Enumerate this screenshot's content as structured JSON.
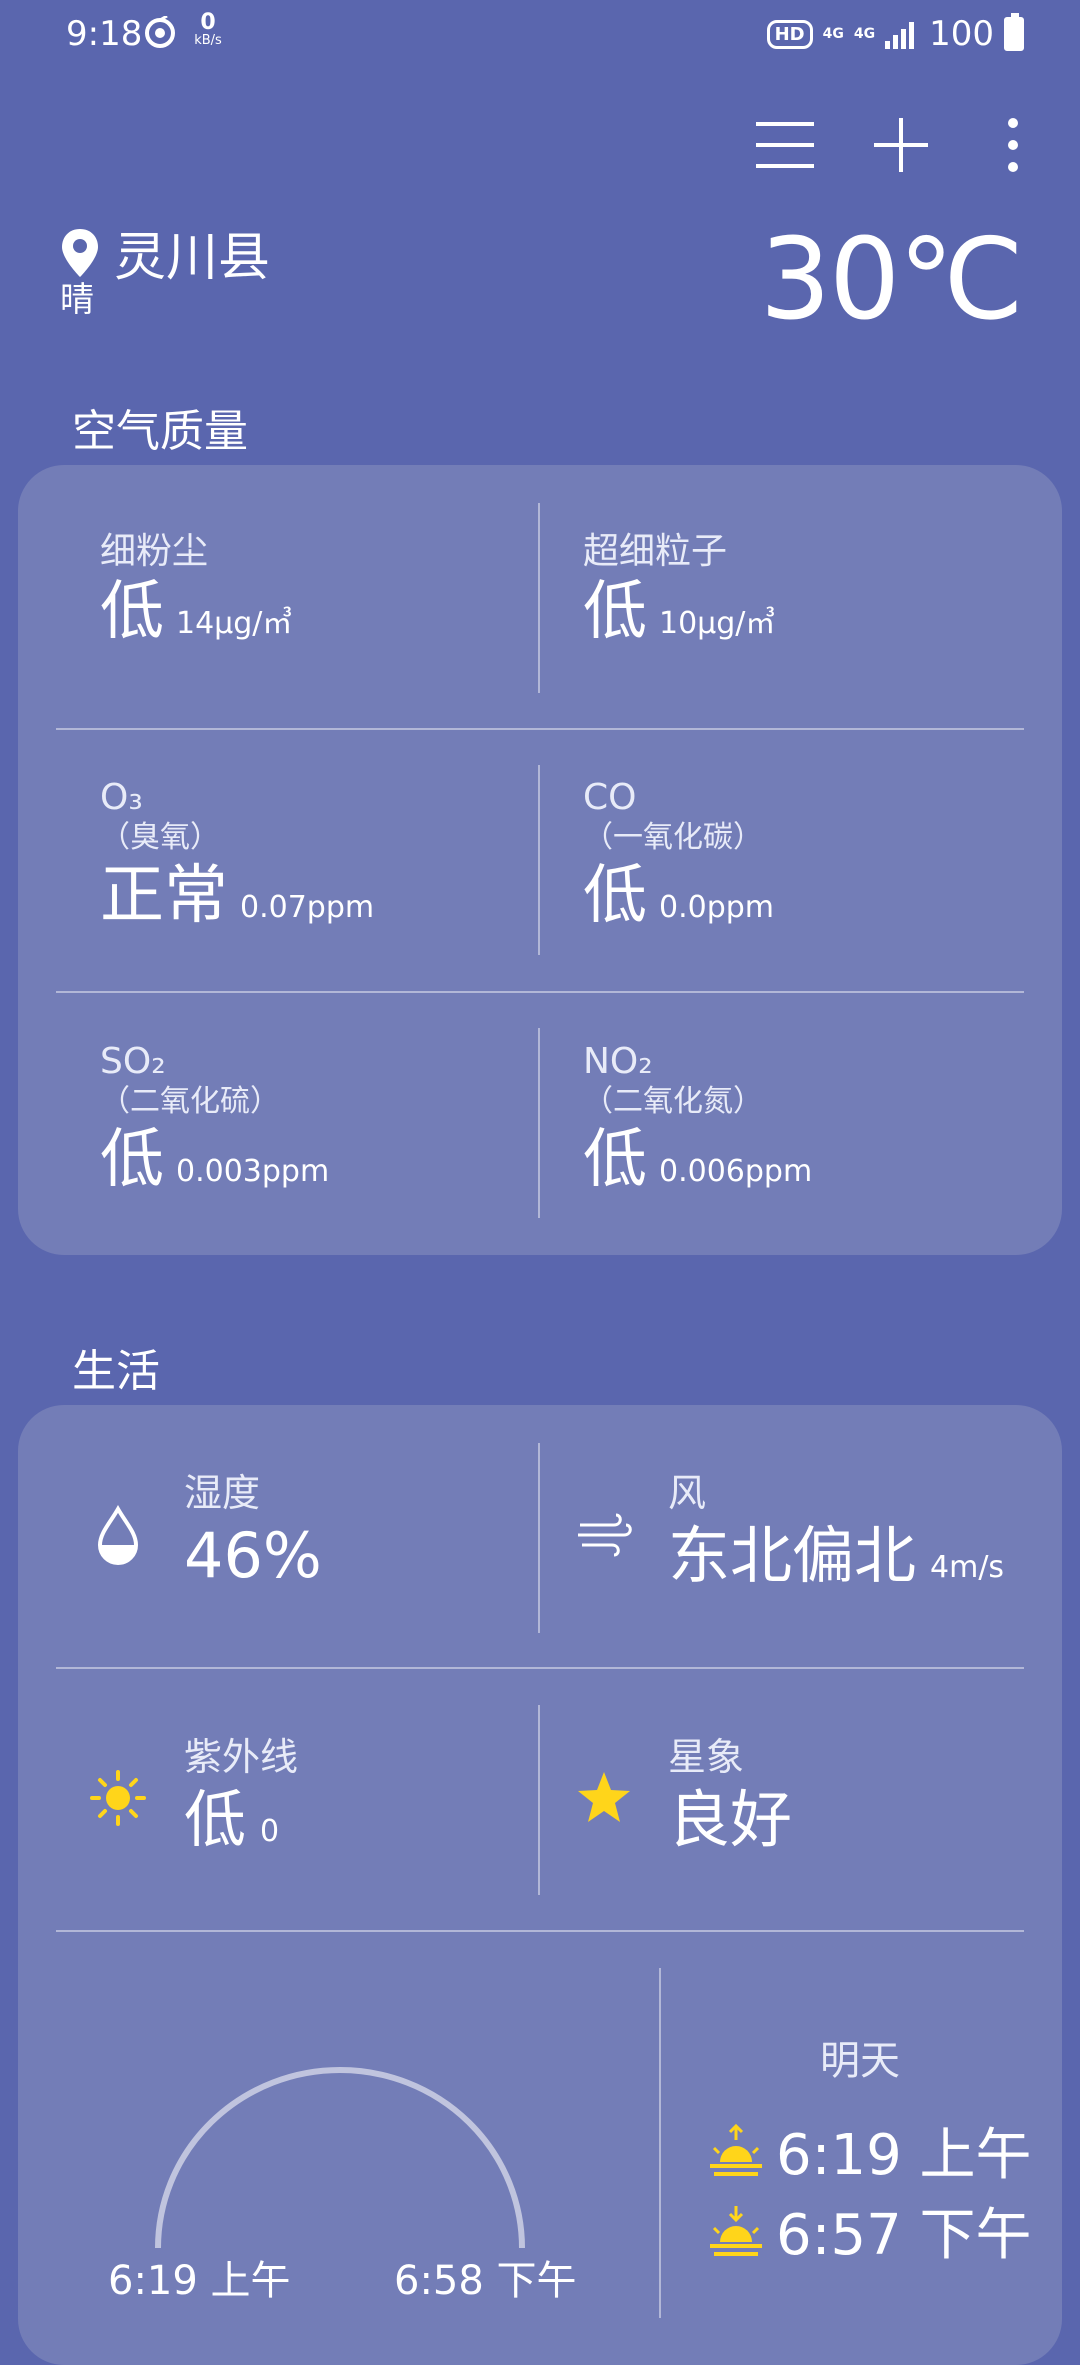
{
  "status_bar": {
    "time": "9:18",
    "speed_value": "0",
    "speed_unit": "kB/s",
    "hd": "HD",
    "net1": "4G",
    "net2": "4G",
    "battery": "100"
  },
  "location": {
    "name": "灵川县",
    "condition": "晴",
    "temperature": "30℃"
  },
  "air_quality": {
    "title": "空气质量",
    "items": [
      {
        "label": "细粉尘",
        "sub": "",
        "level": "低",
        "amount": "14μg/㎥"
      },
      {
        "label": "超细粒子",
        "sub": "",
        "level": "低",
        "amount": "10μg/㎥"
      },
      {
        "label": "O₃",
        "sub": "（臭氧）",
        "level": "正常",
        "amount": "0.07ppm"
      },
      {
        "label": "CO",
        "sub": "（一氧化碳）",
        "level": "低",
        "amount": "0.0ppm"
      },
      {
        "label": "SO₂",
        "sub": "（二氧化硫）",
        "level": "低",
        "amount": "0.003ppm"
      },
      {
        "label": "NO₂",
        "sub": "（二氧化氮）",
        "level": "低",
        "amount": "0.006ppm"
      }
    ]
  },
  "life": {
    "title": "生活",
    "humidity": {
      "label": "湿度",
      "value": "46%",
      "icon": "water-drop-icon"
    },
    "wind": {
      "label": "风",
      "value": "东北偏北",
      "extra": "4m/s",
      "icon": "wind-icon"
    },
    "uv": {
      "label": "紫外线",
      "value": "低",
      "extra": "0",
      "icon": "sun-icon"
    },
    "stars": {
      "label": "星象",
      "value": "良好",
      "icon": "star-icon"
    },
    "sunrise_today": "6:19 上午",
    "sunset_today": "6:58 下午",
    "tomorrow_label": "明天",
    "sunrise_tomorrow": "6:19 上午",
    "sunset_tomorrow": "6:57 下午"
  },
  "colors": {
    "background": "#5a66ae",
    "card": "#737db7",
    "accent_yellow": "#ffd51a"
  }
}
